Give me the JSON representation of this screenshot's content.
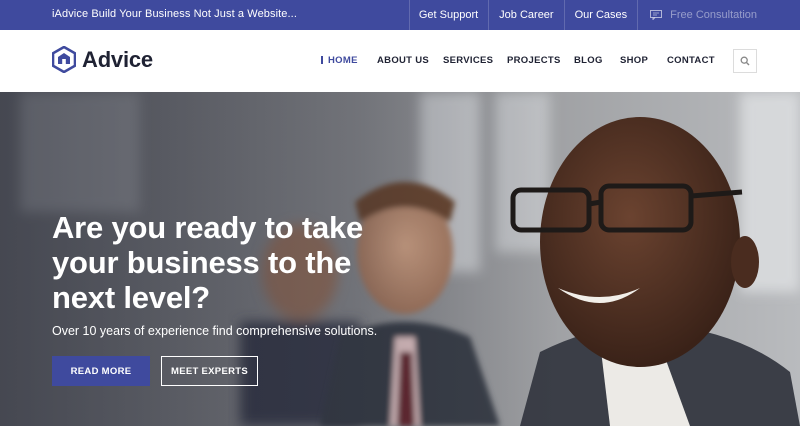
{
  "topbar": {
    "tagline": "iAdvice Build Your Business Not Just a Website...",
    "links": [
      "Get Support",
      "Job Career",
      "Our Cases"
    ],
    "consultation": "Free Consultation"
  },
  "header": {
    "brand": "Advice",
    "nav": [
      "HOME",
      "ABOUT US",
      "SERVICES",
      "PROJECTS",
      "BLOG",
      "SHOP",
      "CONTACT"
    ],
    "active_nav": "HOME"
  },
  "hero": {
    "title": "Are you ready to take your business to the next level?",
    "subtitle": "Over 10 years of experience find comprehensive solutions.",
    "primary_button": "READ MORE",
    "secondary_button": "MEET EXPERTS"
  },
  "colors": {
    "brand": "#3f4a9e",
    "text_dark": "#1f2233"
  },
  "icons": {
    "logo": "hexagon-house-icon",
    "consultation": "chat-icon",
    "search": "search-icon"
  }
}
